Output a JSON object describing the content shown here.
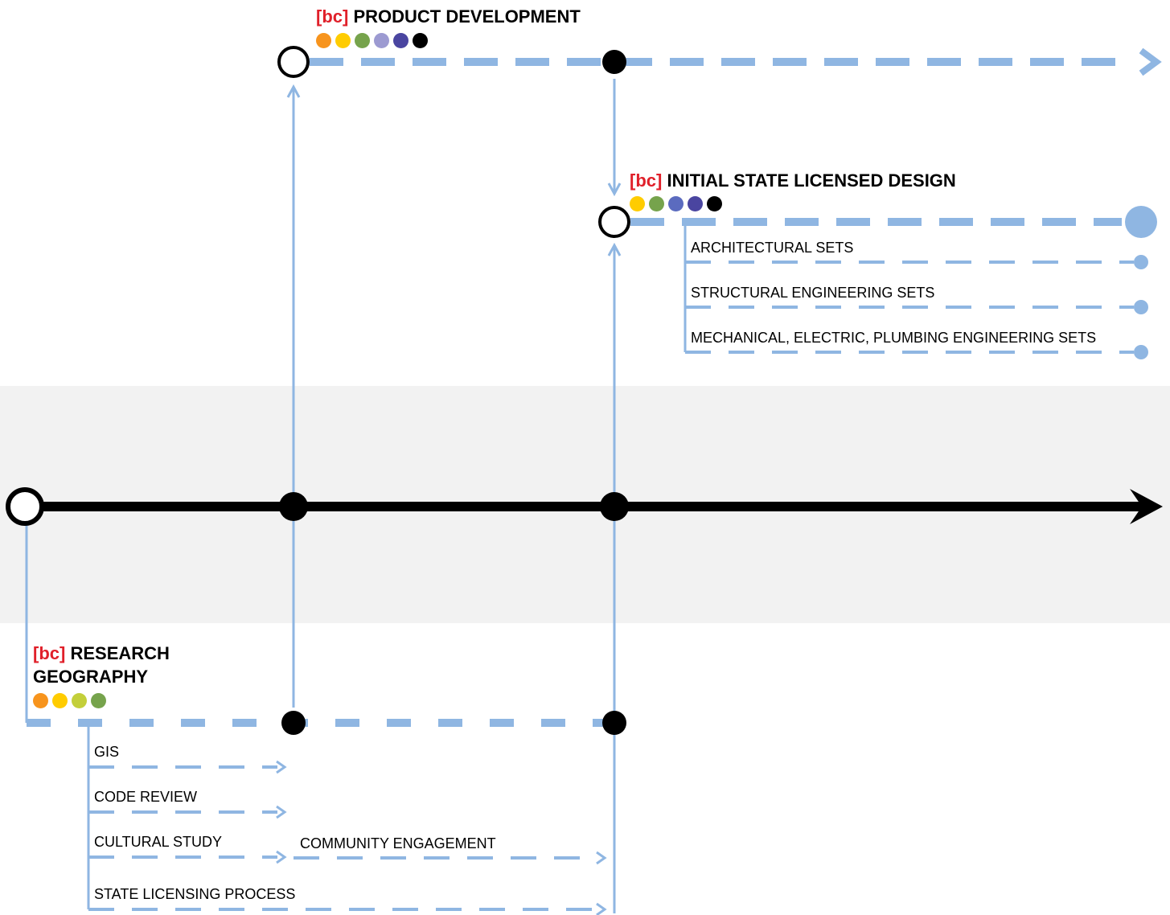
{
  "colors": {
    "blue": "#8fb6e2",
    "black": "#000000",
    "band": "#f2f2f2",
    "tag_red": "#e0202a"
  },
  "headings": {
    "product_development": {
      "tag": "[bc]",
      "title": "PRODUCT DEVELOPMENT",
      "dots": [
        "#f7941d",
        "#ffcc00",
        "#76a34c",
        "#9c9ad1",
        "#4a45a0",
        "#000000"
      ]
    },
    "initial_state": {
      "tag": "[bc]",
      "title": "INITIAL STATE LICENSED DESIGN",
      "dots": [
        "#ffcc00",
        "#76a34c",
        "#5b6bbf",
        "#4a45a0",
        "#000000"
      ]
    },
    "research": {
      "tag": "[bc]",
      "title_line1": "RESEARCH",
      "title_line2": "GEOGRAPHY",
      "dots": [
        "#f7941d",
        "#ffcc00",
        "#c3cf3a",
        "#76a34c"
      ]
    }
  },
  "design_items": [
    "ARCHITECTURAL SETS",
    "STRUCTURAL ENGINEERING SETS",
    "MECHANICAL, ELECTRIC, PLUMBING ENGINEERING SETS"
  ],
  "research_items": [
    "GIS",
    "CODE REVIEW",
    "CULTURAL STUDY",
    "STATE LICENSING  PROCESS"
  ],
  "community_item": "COMMUNITY ENGAGEMENT"
}
